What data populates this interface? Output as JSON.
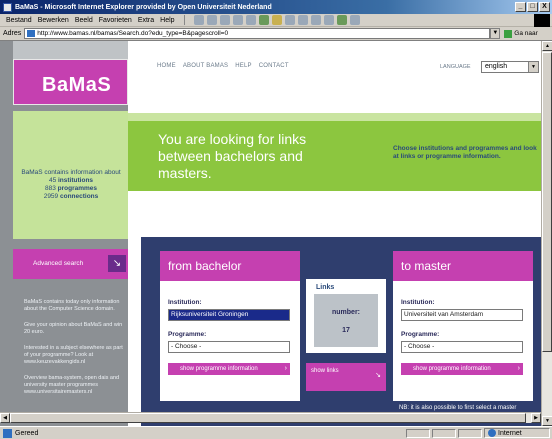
{
  "window": {
    "title": "BaMaS - Microsoft Internet Explorer provided by Open Universiteit Nederland",
    "controls": [
      "_",
      "□",
      "X"
    ]
  },
  "menu": [
    "Bestand",
    "Bewerken",
    "Beeld",
    "Favorieten",
    "Extra",
    "Help"
  ],
  "address": {
    "label": "Adres",
    "url": "http://www.bamas.nl/bamas/Search.do?edu_type=B&pagescroll=0",
    "go_label": "Ga naar"
  },
  "site": {
    "logo": "BaMaS",
    "nav": [
      "HOME",
      "ABOUT BAMAS",
      "HELP",
      "CONTACT"
    ],
    "language_label": "LANGUAGE",
    "language_value": "english",
    "hero": "You are looking for links between bachelors and masters.",
    "side_note": "Choose institutions and programmes and look at links or programme information.",
    "info": {
      "intro": "BaMaS contains information about",
      "institutions_count": "45",
      "institutions_label": "institutions",
      "programmes_count": "883",
      "programmes_label": "programmes",
      "connections_count": "2959",
      "connections_label": "connections"
    },
    "advanced_search": "Advanced search",
    "left_info": [
      "BaMaS contains today only information about the Computer Science domain.",
      "Give your opinion about BaMaS and win 20 euro.",
      "Interested in a subject elsewhere as part of your programme? Look at www.keuzevakkengids.nl",
      "Overview bama-system, open dais and university master programmes www.universitairemasters.nl"
    ],
    "from": {
      "title": "from bachelor",
      "institution_label": "Institution:",
      "institution_value": "Rijksuniversiteit Groningen",
      "programme_label": "Programme:",
      "programme_value": "- Choose -",
      "button": "show programme information"
    },
    "to": {
      "title": "to master",
      "institution_label": "Institution:",
      "institution_value": "Universiteit van Amsterdam",
      "programme_label": "Programme:",
      "programme_value": "- Choose -",
      "button": "show programme information"
    },
    "links": {
      "title": "Links",
      "number_label": "number:",
      "number_value": "17",
      "show_button": "show links"
    },
    "nb": "NB: it is also possible to first select a master followed by a search for the connected bachelors."
  },
  "status": {
    "text": "Gereed",
    "zone": "Internet"
  },
  "colors": {
    "accent_magenta": "#c540b0",
    "green": "#8cc63f",
    "navy": "#2f3e6e"
  }
}
